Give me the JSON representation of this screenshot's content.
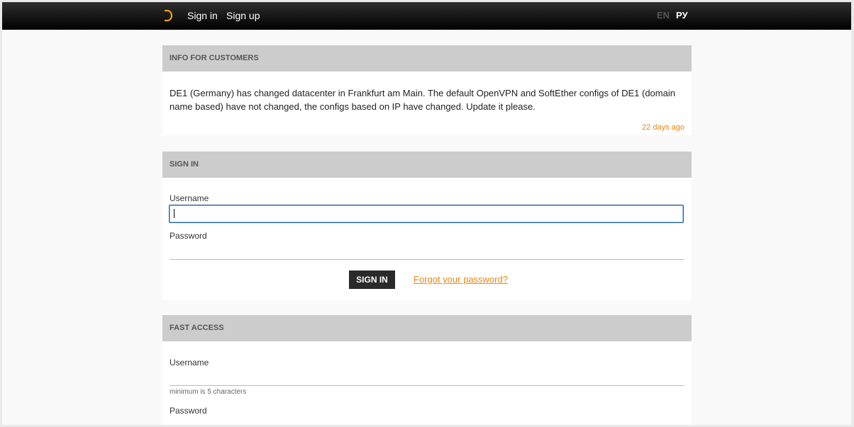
{
  "nav": {
    "links": [
      "Sign in",
      "Sign up"
    ],
    "languages": [
      "EN",
      "РУ"
    ],
    "active_language": "РУ",
    "colors": {
      "accent": "#e8870b",
      "bar": "#000000"
    }
  },
  "info": {
    "header": "INFO FOR CUSTOMERS",
    "message": "DE1 (Germany) has changed datacenter in Frankfurt am Main. The default OpenVPN and SoftEther configs of DE1 (domain name based) have not changed, the configs based on IP have changed. Update it please.",
    "time": "22 days ago"
  },
  "signin": {
    "header": "SIGN IN",
    "username_label": "Username",
    "username_value": "",
    "password_label": "Password",
    "password_value": "",
    "button_label": "SIGN IN",
    "forgot_link": "Forgot your password?"
  },
  "fast_access": {
    "header": "FAST ACCESS",
    "username_label": "Username",
    "username_value": "",
    "username_hint": "minimum is 5 characters",
    "password_label": "Password"
  }
}
